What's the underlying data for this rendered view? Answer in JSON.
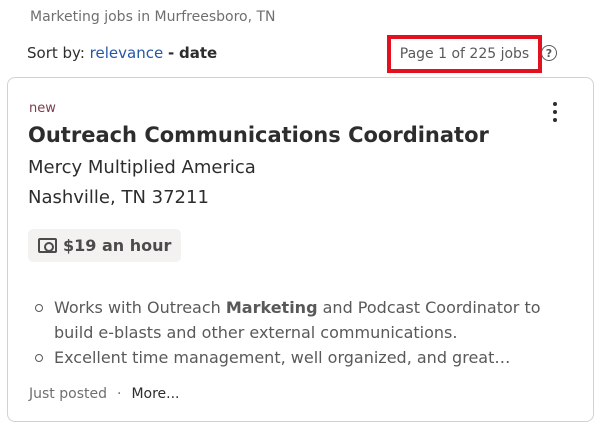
{
  "search_context": "Marketing jobs in Murfreesboro, TN",
  "sort": {
    "prefix": "Sort by:",
    "relevance": "relevance",
    "separator": "-",
    "date": "date"
  },
  "pagination": {
    "text": "Page 1 of 225 jobs",
    "help_glyph": "?"
  },
  "job": {
    "badge": "new",
    "title": "Outreach Communications Coordinator",
    "company": "Mercy Multiplied America",
    "location": "Nashville, TN 37211",
    "salary": "$19 an hour",
    "salary_icon": "money-icon",
    "snippet": [
      {
        "before": "Works with Outreach ",
        "bold": "Marketing",
        "after": " and Podcast Coordinator to build e-blasts and other external communications."
      },
      {
        "before": "Excellent time management, well organized, and great…",
        "bold": "",
        "after": ""
      }
    ],
    "posted": "Just posted",
    "footer_separator": "·",
    "more": "More..."
  },
  "colors": {
    "highlight_box": "#e3101f",
    "link": "#2557a7",
    "new_badge": "#7a3d4b"
  }
}
